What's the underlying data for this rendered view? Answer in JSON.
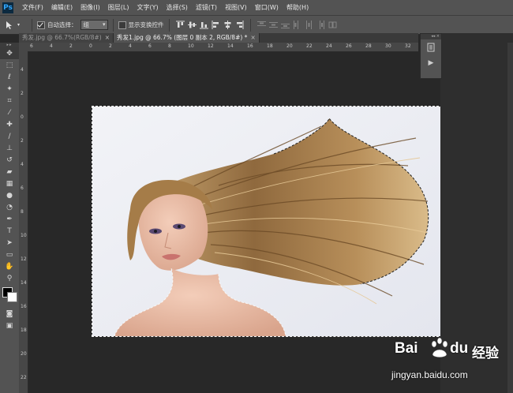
{
  "app": {
    "logo": "Ps"
  },
  "menu": [
    "文件(F)",
    "编辑(E)",
    "图像(I)",
    "图层(L)",
    "文字(Y)",
    "选择(S)",
    "滤镜(T)",
    "视图(V)",
    "窗口(W)",
    "帮助(H)"
  ],
  "options": {
    "auto_select_label": "自动选择：",
    "auto_select_checked": true,
    "auto_select_value": "组",
    "show_transform_label": "显示变换控件",
    "show_transform_checked": false
  },
  "tabs": [
    {
      "label": "秀发.jpg @ 66.7%(RGB/8#)",
      "close": "×",
      "active": false
    },
    {
      "label": "秀发1.jpg @ 66.7% (图层 0 副本 2, RGB/8#) *",
      "close": "×",
      "active": true
    }
  ],
  "ruler": {
    "h_labels": [
      "6",
      "4",
      "2",
      "0",
      "2",
      "4",
      "6",
      "8",
      "10",
      "12",
      "14",
      "16",
      "18",
      "20",
      "22",
      "24",
      "26",
      "28",
      "30",
      "32"
    ],
    "v_labels": [
      "4",
      "2",
      "0",
      "2",
      "4",
      "6",
      "8",
      "10",
      "12",
      "14",
      "16",
      "18",
      "20",
      "22"
    ]
  },
  "tools": [
    {
      "name": "move-tool-icon",
      "glyph": "✥"
    },
    {
      "name": "marquee-tool-icon",
      "glyph": "⬚"
    },
    {
      "name": "lasso-tool-icon",
      "glyph": "ℓ"
    },
    {
      "name": "magic-wand-tool-icon",
      "glyph": "✦"
    },
    {
      "name": "crop-tool-icon",
      "glyph": "⌗"
    },
    {
      "name": "eyedropper-tool-icon",
      "glyph": "⁄"
    },
    {
      "name": "healing-brush-tool-icon",
      "glyph": "✚"
    },
    {
      "name": "brush-tool-icon",
      "glyph": "∕"
    },
    {
      "name": "clone-stamp-tool-icon",
      "glyph": "⊥"
    },
    {
      "name": "history-brush-tool-icon",
      "glyph": "↺"
    },
    {
      "name": "eraser-tool-icon",
      "glyph": "▰"
    },
    {
      "name": "gradient-tool-icon",
      "glyph": "▦"
    },
    {
      "name": "blur-tool-icon",
      "glyph": "●"
    },
    {
      "name": "dodge-tool-icon",
      "glyph": "◔"
    },
    {
      "name": "pen-tool-icon",
      "glyph": "✒"
    },
    {
      "name": "type-tool-icon",
      "glyph": "T"
    },
    {
      "name": "path-selection-tool-icon",
      "glyph": "➤"
    },
    {
      "name": "shape-tool-icon",
      "glyph": "▭"
    },
    {
      "name": "hand-tool-icon",
      "glyph": "✋"
    },
    {
      "name": "zoom-tool-icon",
      "glyph": "⚲"
    }
  ],
  "colors": {
    "foreground": "#000000",
    "background": "#ffffff",
    "menu_bg": "#535353",
    "canvas_bg": "#282828"
  },
  "watermark": {
    "brand": "Bai",
    "brand2": "du",
    "product": "经验",
    "url": "jingyan.baidu.com"
  }
}
